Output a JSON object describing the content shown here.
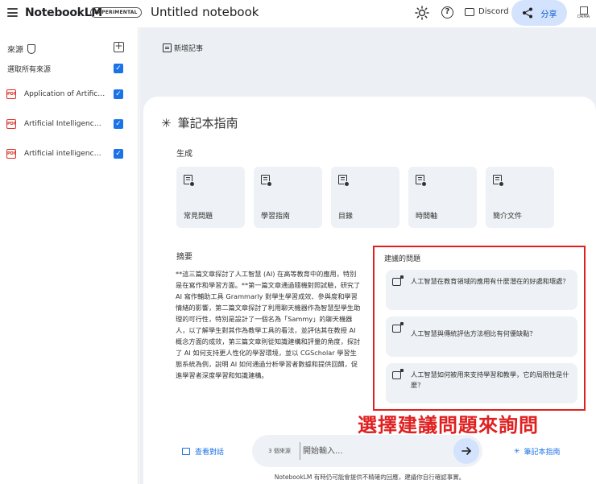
{
  "topbar": {
    "brand": "NotebookLM",
    "badge": "EXPERIMENTAL",
    "notebook_title": "Untitled notebook",
    "discord_label": "Discord",
    "share_label": "分享",
    "grid_label": "DRMA"
  },
  "sidebar": {
    "sources_heading": "來源",
    "select_all_label": "選取所有來源",
    "items": [
      {
        "label": "Application of Artificial Intelligence in Education",
        "type": "PDF"
      },
      {
        "label": "Artificial Intelligence (AI) in Education",
        "type": "PDF"
      },
      {
        "label": "Artificial intelligence for learning",
        "type": "PDF"
      }
    ]
  },
  "main": {
    "add_note_label": "新增記事",
    "guide_title": "筆記本指南",
    "generate_label": "生成",
    "generate_items": [
      "常見問題",
      "學習指南",
      "目錄",
      "時間軸",
      "簡介文件"
    ],
    "summary_label": "摘要",
    "summary_text": "**這三篇文章探討了人工智慧 (AI) 在高等教育中的應用，特別是在寫作和學習方面。**第一篇文章通過隨機對照試驗，研究了 AI 寫作輔助工具 Grammarly 對學生學習成效、參與度和學習情緒的影響，第二篇文章探討了利用聊天機器作為智慧型學生助理的可行性，特別是設計了一個名為「Sammy」的聊天機器人，以了解學生對其作為教學工具的看法，並評估其在教授 AI 概念方面的成效，第三篇文章則從知識建構和評量的角度，探討了 AI 如何支持更人性化的學習環境，並以 CGScholar 學習生態系統為例，說明 AI 如何通過分析學習者數據和提供回饋，促進學習者深度學習和知識建構。",
    "suggested_label": "建議的問題",
    "suggested_questions": [
      "人工智慧在教育領域的應用有什麼潛在的好處和壞處？",
      "人工智慧與傳統評估方法相比有何優缺點？",
      "人工智慧如何被用來支持學習和教學，它的局限性是什麼？"
    ],
    "callout": "選擇建議問題來詢問",
    "view_chat_label": "查看對話",
    "source_count": "3 個來源",
    "input_placeholder": "開始輸入...",
    "notebook_guide_label": "筆記本指南",
    "disclaimer": "NotebookLM 有時仍可能會提供不精確的回應，建議你自行確認事實。"
  },
  "colors": {
    "accent": "#1a73e8",
    "highlight": "#e02020",
    "share_bg": "#d3e3fd"
  }
}
